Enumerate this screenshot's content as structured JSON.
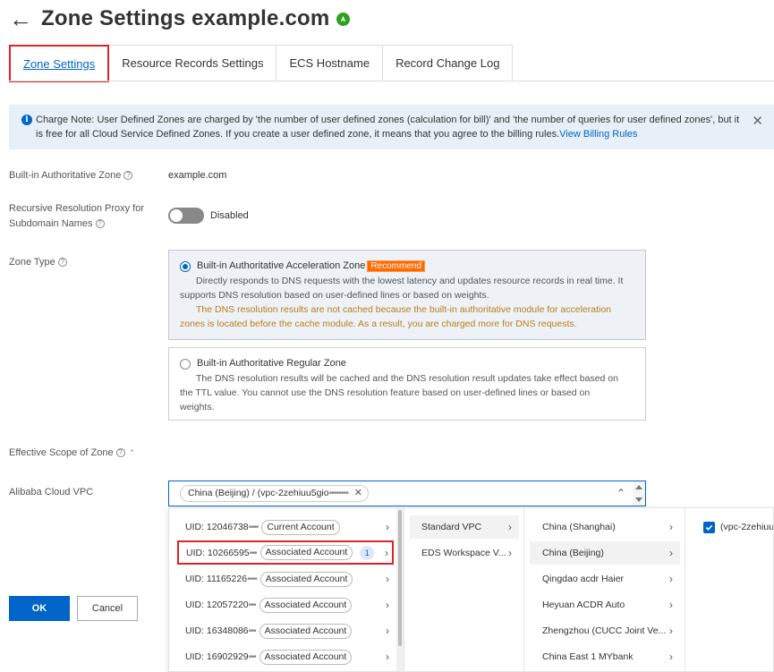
{
  "header": {
    "title": "Zone Settings example.com",
    "back_icon": "arrow-left-icon",
    "status_icon": "check-circle-icon"
  },
  "tabs": [
    {
      "label": "Zone Settings",
      "active": true
    },
    {
      "label": "Resource Records Settings"
    },
    {
      "label": "ECS Hostname"
    },
    {
      "label": "Record Change Log"
    }
  ],
  "notice": {
    "text": "Charge Note: User Defined Zones are charged by 'the number of user defined zones (calculation for bill)' and 'the number of queries for user defined zones', but it is free for all Cloud Service Defined Zones. If you create a user defined zone, it means that you agree to the billing rules.",
    "link": "View Billing Rules"
  },
  "form": {
    "auth_zone_label": "Built-in Authoritative Zone",
    "auth_zone_value": "example.com",
    "recursive_label_1": "Recursive Resolution Proxy for",
    "recursive_label_2": "Subdomain Names",
    "recursive_state": "Disabled",
    "zone_type_label": "Zone Type",
    "option1": {
      "title": "Built-in Authoritative Acceleration Zone",
      "badge": "Recommend",
      "desc1": "Directly responds to DNS requests with the lowest latency and updates resource records in real time. It",
      "desc2": "supports DNS resolution based on user-defined lines or based on weights.",
      "warn1": "The DNS resolution results are not cached because the built-in authoritative module for acceleration",
      "warn2": "zones is located before the cache module. As a result, you are charged more for DNS requests."
    },
    "option2": {
      "title": "Built-in Authoritative Regular Zone",
      "desc1": "The DNS resolution results will be cached and the DNS resolution result updates take effect based on",
      "desc2": "the TTL value. You cannot use the DNS resolution feature based on user-defined lines or based on",
      "desc3": "weights."
    },
    "scope_label": "Effective Scope of Zone",
    "vpc_label": "Alibaba Cloud VPC",
    "selected_tag": "China (Beijing) / (vpc-2zehiuu5gio",
    "selected_tag_masked": "••••••••"
  },
  "accounts": [
    {
      "uid": "UID: 12046738",
      "masked": "••••",
      "type": "Current Account"
    },
    {
      "uid": "UID: 10266595",
      "masked": "•••",
      "type": "Associated Account",
      "count": "1"
    },
    {
      "uid": "UID: 11165226",
      "masked": "••••",
      "type": "Associated Account"
    },
    {
      "uid": "UID: 12057220",
      "masked": "•••",
      "type": "Associated Account"
    },
    {
      "uid": "UID: 16348086",
      "masked": "•••",
      "type": "Associated Account"
    },
    {
      "uid": "UID: 16902929",
      "masked": "•••",
      "type": "Associated Account"
    }
  ],
  "vpc_types": [
    "Standard VPC",
    "EDS Workspace V..."
  ],
  "regions": [
    "China (Shanghai)",
    "China (Beijing)",
    "Qingdao acdr Haier",
    "Heyuan ACDR Auto",
    "Zhengzhou (CUCC Joint Ve...",
    "China East 1 MYbank"
  ],
  "vpc_item": "(vpc-2zehiuu",
  "buttons": {
    "ok": "OK",
    "cancel": "Cancel"
  }
}
